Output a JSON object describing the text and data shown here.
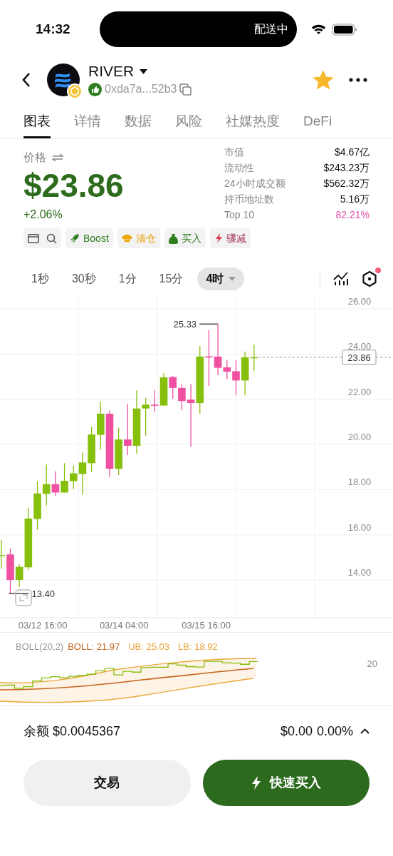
{
  "status_bar": {
    "time": "14:32",
    "activity": "配送中"
  },
  "header": {
    "token": "RIVER",
    "address": "0xda7a...52b3",
    "favorite": true
  },
  "tabs": [
    {
      "label": "图表",
      "selected": true
    },
    {
      "label": "详情",
      "selected": false
    },
    {
      "label": "数据",
      "selected": false
    },
    {
      "label": "风险",
      "selected": false
    },
    {
      "label": "社媒热度",
      "selected": false
    },
    {
      "label": "DeFi",
      "selected": false
    }
  ],
  "price": {
    "label": "价格",
    "value": "$23.86",
    "change": "+2.06%"
  },
  "stats": [
    {
      "label": "市值",
      "value": "$4.67亿",
      "color": "#111111"
    },
    {
      "label": "流动性",
      "value": "$243.23万",
      "color": "#111111"
    },
    {
      "label": "24小时成交额",
      "value": "$562.32万",
      "color": "#111111"
    },
    {
      "label": "持币地址数",
      "value": "5.16万",
      "color": "#111111"
    },
    {
      "label": "Top 10",
      "value": "82.21%",
      "color": "#e04fa8"
    }
  ],
  "chips": [
    {
      "kind": "tools"
    },
    {
      "kind": "boost",
      "label": "Boost"
    },
    {
      "kind": "clear",
      "label": "清仓"
    },
    {
      "kind": "buy",
      "label": "买入"
    },
    {
      "kind": "dump",
      "label": "骤减"
    }
  ],
  "intervals": [
    {
      "label": "1秒",
      "selected": false
    },
    {
      "label": "30秒",
      "selected": false
    },
    {
      "label": "1分",
      "selected": false
    },
    {
      "label": "15分",
      "selected": false
    },
    {
      "label": "4时",
      "selected": true
    }
  ],
  "settings_badge": true,
  "chart": {
    "y_labels": [
      "26.00",
      "24.00",
      "22.00",
      "20.00",
      "18.00",
      "16.00",
      "14.00"
    ],
    "x_labels": [
      "03/12 16:00",
      "03/14 04:00",
      "03/15 16:00"
    ],
    "high_label": "25.33",
    "low_label": "13.40",
    "last_price": "23.86"
  },
  "indicator": {
    "name": "BOLL(20,2)",
    "mid": "BOLL: 21.97",
    "upper": "UB: 25.03",
    "lower": "LB: 18.92",
    "tick": "20"
  },
  "footer": {
    "balance_label": "余额",
    "balance": "$0.0045367",
    "pnl": "$0.00",
    "pnl_pct": "0.00%"
  },
  "buttons": [
    {
      "kind": "secondary",
      "label": "交易"
    },
    {
      "kind": "primary",
      "label": "快速买入"
    }
  ]
}
